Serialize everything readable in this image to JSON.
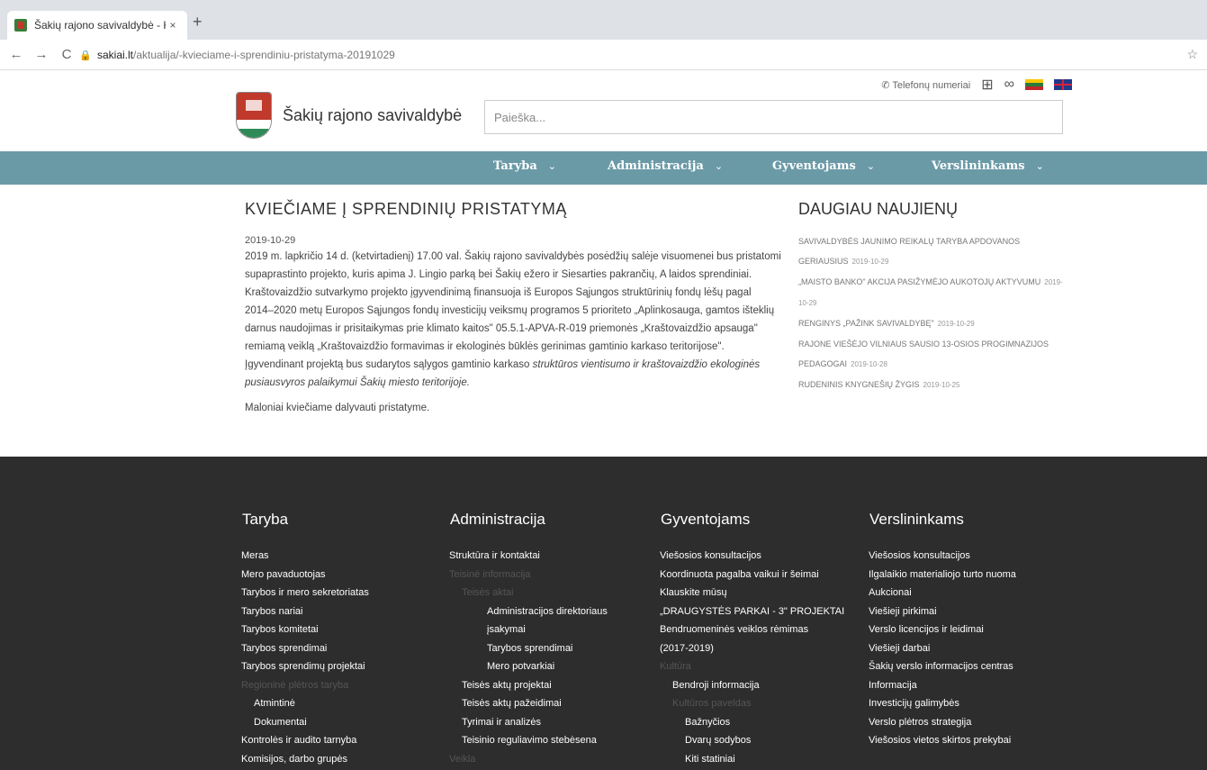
{
  "browser": {
    "tab_title": "Šakių rajono savivaldybė - KVIEČ",
    "tab_close": "×",
    "new_tab": "+",
    "url_host": "sakiai.lt",
    "url_path": "/aktualija/-kvieciame-i-sprendiniu-pristatyma-20191029",
    "back": "←",
    "forward": "→",
    "reload": "C",
    "star": "☆"
  },
  "utility": {
    "phones_label": "Telefonų numeriai"
  },
  "header": {
    "site_name": "Šakių rajono savivaldybė",
    "search_placeholder": "Paieška..."
  },
  "nav": [
    {
      "label": "Taryba"
    },
    {
      "label": "Administracija"
    },
    {
      "label": "Gyventojams"
    },
    {
      "label": "Verslininkams"
    }
  ],
  "article": {
    "title": "KVIEČIAME Į SPRENDINIŲ PRISTATYMĄ",
    "date": "2019-10-29",
    "body": "2019 m. lapkričio 14 d. (ketvirtadienį) 17.00 val. Šakių rajono savivaldybės posėdžių salėje visuomenei bus pristatomi supaprastinto projekto, kuris apima J. Lingio parką bei Šakių ežero ir Siesarties pakrančių, A laidos sprendiniai. Kraštovaizdžio sutvarkymo projekto įgyvendinimą finansuoja iš Europos Sąjungos struktūrinių fondų lėšų pagal 2014–2020 metų Europos Sąjungos fondų investicijų veiksmų programos 5 prioriteto „Aplinkosauga, gamtos išteklių darnus naudojimas ir prisitaikymas prie klimato kaitos\" 05.5.1-APVA-R-019 priemonės „Kraštovaizdžio apsauga\" remiamą veiklą „Kraštovaizdžio formavimas ir ekologinės būklės gerinimas gamtinio karkaso teritorijose\". Įgyvendinant projektą bus sudarytos sąlygos gamtinio karkaso",
    "body_italic": "struktūros vientisumo ir kraštovaizdžio ekologinės pusiausvyros palaikymui Šakių miesto teritorijoje.",
    "closing": "Maloniai kviečiame dalyvauti pristatyme."
  },
  "aside": {
    "title": "DAUGIAU NAUJIENŲ",
    "items": [
      {
        "text": "SAVIVALDYBĖS JAUNIMO REIKALŲ TARYBA APDOVANOS GERIAUSIUS",
        "date": "2019-10-29"
      },
      {
        "text": "„MAISTO BANKO\" AKCIJA PASIŽYMĖJO AUKOTOJŲ AKTYVUMU",
        "date": "2019-10-29"
      },
      {
        "text": "RENGINYS „PAŽINK SAVIVALDYBĘ\"",
        "date": "2019-10-29"
      },
      {
        "text": "RAJONE VIEŠĖJO VILNIAUS SAUSIO 13-OSIOS PROGIMNAZIJOS PEDAGOGAI",
        "date": "2019-10-28"
      },
      {
        "text": "RUDENINIS KNYGNEŠIŲ ŽYGIS",
        "date": "2019-10-25"
      }
    ]
  },
  "footer": {
    "col1": {
      "title": "Taryba",
      "items": [
        {
          "text": "Meras",
          "lvl": 0
        },
        {
          "text": "Mero pavaduotojas",
          "lvl": 0
        },
        {
          "text": "Tarybos ir mero sekretoriatas",
          "lvl": 0
        },
        {
          "text": "Tarybos nariai",
          "lvl": 0
        },
        {
          "text": "Tarybos komitetai",
          "lvl": 0
        },
        {
          "text": "Tarybos sprendimai",
          "lvl": 0
        },
        {
          "text": "Tarybos sprendimų projektai",
          "lvl": 0
        },
        {
          "text": "Regioninė plėtros taryba",
          "lvl": 0,
          "grey": true
        },
        {
          "text": "Atmintinė",
          "lvl": 1
        },
        {
          "text": "Dokumentai",
          "lvl": 1
        },
        {
          "text": "Kontrolės ir audito tarnyba",
          "lvl": 0
        },
        {
          "text": "Komisijos, darbo grupės",
          "lvl": 0
        }
      ]
    },
    "col2": {
      "title": "Administracija",
      "items": [
        {
          "text": "Struktūra ir kontaktai",
          "lvl": 0
        },
        {
          "text": "Teisinė informacija",
          "lvl": 0,
          "grey": true
        },
        {
          "text": "Teisės aktai",
          "lvl": 1,
          "grey": true
        },
        {
          "text": "Administracijos direktoriaus",
          "lvl": 3
        },
        {
          "text": "įsakymai",
          "lvl": 3
        },
        {
          "text": "Tarybos sprendimai",
          "lvl": 3
        },
        {
          "text": "Mero potvarkiai",
          "lvl": 3
        },
        {
          "text": "Teisės aktų projektai",
          "lvl": 1
        },
        {
          "text": "Teisės aktų pažeidimai",
          "lvl": 1
        },
        {
          "text": "Tyrimai ir analizės",
          "lvl": 1
        },
        {
          "text": "Teisinio reguliavimo stebėsena",
          "lvl": 1
        },
        {
          "text": "Veikla",
          "lvl": 0,
          "grey": true
        }
      ]
    },
    "col3": {
      "title": "Gyventojams",
      "items": [
        {
          "text": "Viešosios konsultacijos",
          "lvl": 0
        },
        {
          "text": "Koordinuota pagalba vaikui ir šeimai",
          "lvl": 0
        },
        {
          "text": "Klauskite mūsų",
          "lvl": 0
        },
        {
          "text": "„DRAUGYSTĖS PARKAI - 3\" PROJEKTAI",
          "lvl": 0
        },
        {
          "text": "Bendruomeninės veiklos rėmimas",
          "lvl": 0
        },
        {
          "text": "(2017-2019)",
          "lvl": 0
        },
        {
          "text": "Kultūra",
          "lvl": 0,
          "grey": true
        },
        {
          "text": "Bendroji informacija",
          "lvl": 1
        },
        {
          "text": "Kultūros paveldas",
          "lvl": 1,
          "grey": true
        },
        {
          "text": "Bažnyčios",
          "lvl": 2
        },
        {
          "text": "Dvarų sodybos",
          "lvl": 2
        },
        {
          "text": "Kiti statiniai",
          "lvl": 2
        }
      ]
    },
    "col4": {
      "title": "Verslininkams",
      "items": [
        {
          "text": "Viešosios konsultacijos",
          "lvl": 0
        },
        {
          "text": "Ilgalaikio materialiojo turto nuoma",
          "lvl": 0
        },
        {
          "text": "Aukcionai",
          "lvl": 0
        },
        {
          "text": "Viešieji pirkimai",
          "lvl": 0
        },
        {
          "text": "Verslo licencijos ir leidimai",
          "lvl": 0
        },
        {
          "text": "Viešieji darbai",
          "lvl": 0
        },
        {
          "text": "Šakių verslo informacijos centras",
          "lvl": 0
        },
        {
          "text": "Informacija",
          "lvl": 0
        },
        {
          "text": "Investicijų galimybės",
          "lvl": 0
        },
        {
          "text": "Verslo plėtros strategija",
          "lvl": 0
        },
        {
          "text": "Viešosios vietos skirtos prekybai",
          "lvl": 0
        }
      ]
    }
  }
}
